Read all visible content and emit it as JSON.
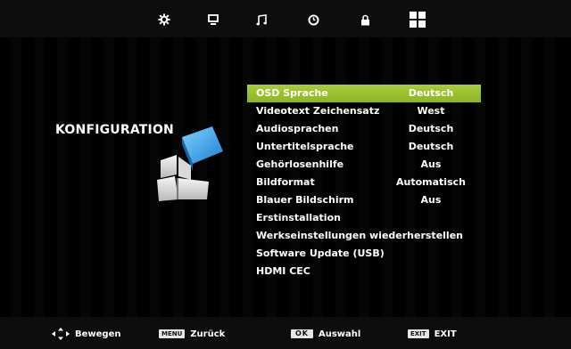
{
  "tabs": [
    {
      "icon": "picture-settings-icon"
    },
    {
      "icon": "monitor-icon"
    },
    {
      "icon": "music-note-icon"
    },
    {
      "icon": "clock-icon"
    },
    {
      "icon": "lock-icon"
    },
    {
      "icon": "grid-icon"
    }
  ],
  "section": {
    "title": "KONFIGURATION"
  },
  "menu": {
    "selected_index": 0,
    "items": [
      {
        "label": "OSD Sprache",
        "value": "Deutsch"
      },
      {
        "label": "Videotext Zeichensatz",
        "value": "West"
      },
      {
        "label": "Audiosprachen",
        "value": "Deutsch"
      },
      {
        "label": "Untertitelsprache",
        "value": "Deutsch"
      },
      {
        "label": "Gehörlosenhilfe",
        "value": "Aus"
      },
      {
        "label": "Bildformat",
        "value": "Automatisch"
      },
      {
        "label": "Blauer Bildschirm",
        "value": "Aus"
      },
      {
        "label": "Erstinstallation",
        "value": ""
      },
      {
        "label": "Werkseinstellungen wiederherstellen",
        "value": ""
      },
      {
        "label": "Software Update (USB)",
        "value": ""
      },
      {
        "label": "HDMI CEC",
        "value": ""
      }
    ]
  },
  "footer": {
    "move_label": "Bewegen",
    "menu_key": "MENU",
    "back_label": "Zurück",
    "ok_key": "OK",
    "select_label": "Auswahl",
    "exit_key": "EXIT",
    "exit_label": "EXIT"
  },
  "colors": {
    "highlight": "#9cc62e",
    "background": "#000000"
  }
}
